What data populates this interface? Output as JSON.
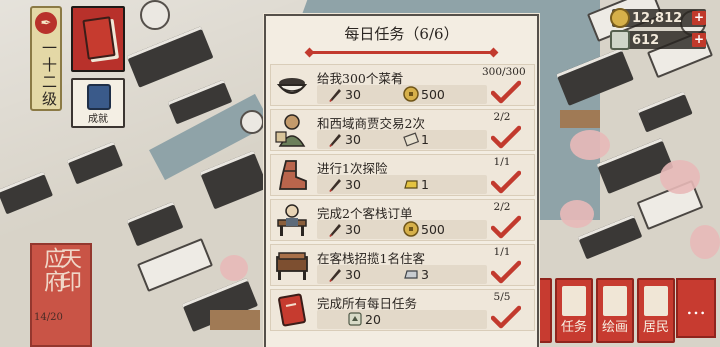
{
  "player": {
    "level": "一十二级"
  },
  "sidebar": {
    "achievement_label": "成就"
  },
  "seal": {
    "line1": "天印",
    "line2": "应府",
    "date": "14/20"
  },
  "currency": {
    "coins": "12,812",
    "tickets": "612",
    "plus": "+"
  },
  "panel": {
    "title": "每日任务（6/6）",
    "tasks": [
      {
        "name": "给我300个菜肴",
        "progress": "300/300",
        "rewards": [
          {
            "icon": "brush-icon",
            "amount": "30"
          },
          {
            "icon": "coin-icon",
            "amount": "500"
          }
        ],
        "task_icon": "bowl-icon"
      },
      {
        "name": "和西域商贾交易2次",
        "progress": "2/2",
        "rewards": [
          {
            "icon": "brush-icon",
            "amount": "30"
          },
          {
            "icon": "scroll-icon",
            "amount": "1"
          }
        ],
        "task_icon": "merchant-icon"
      },
      {
        "name": "进行1次探险",
        "progress": "1/1",
        "rewards": [
          {
            "icon": "brush-icon",
            "amount": "30"
          },
          {
            "icon": "gold-bar-icon",
            "amount": "1"
          }
        ],
        "task_icon": "boot-icon"
      },
      {
        "name": "完成2个客栈订单",
        "progress": "2/2",
        "rewards": [
          {
            "icon": "brush-icon",
            "amount": "30"
          },
          {
            "icon": "coin-icon",
            "amount": "500"
          }
        ],
        "task_icon": "innkeeper-icon"
      },
      {
        "name": "在客栈招揽1名住客",
        "progress": "1/1",
        "rewards": [
          {
            "icon": "brush-icon",
            "amount": "30"
          },
          {
            "icon": "silver-bar-icon",
            "amount": "3"
          }
        ],
        "task_icon": "bed-icon"
      },
      {
        "name": "完成所有每日任务",
        "progress": "5/5",
        "rewards": [
          {
            "icon": "ticket-icon",
            "amount": "20"
          }
        ],
        "task_icon": "task-book-icon"
      }
    ]
  },
  "bottom_buttons": [
    {
      "label": "任务"
    },
    {
      "label": "绘画"
    },
    {
      "label": "居民"
    }
  ],
  "more_label": "…",
  "colors": {
    "accent_red": "#c23a2e",
    "panel_bg": "#f3ede2",
    "text": "#2b2622"
  }
}
